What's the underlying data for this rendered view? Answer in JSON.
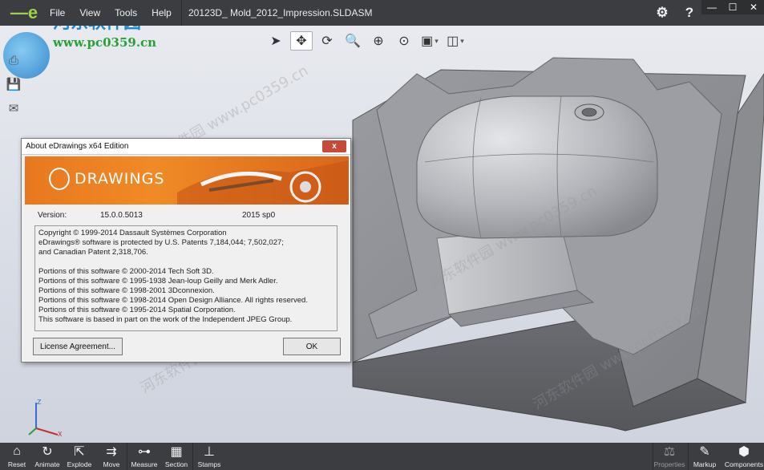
{
  "menu": [
    "File",
    "View",
    "Tools",
    "Help"
  ],
  "document_title": "20123D_ Mold_2012_Impression.SLDASM",
  "top_icons": [
    "gear-icon",
    "help-icon"
  ],
  "window_controls": [
    "—",
    "☐",
    "✕"
  ],
  "watermark": {
    "title": "河东软件园",
    "url": "www.pc0359.cn",
    "diagonal": "河东软件园 www.pc0359.cn"
  },
  "view_toolbar": [
    "select-icon",
    "pan-icon",
    "rotate-icon",
    "zoom-to-fit-icon",
    "zoom-icon",
    "zoom-area-icon",
    "views-icon",
    "display-style-icon"
  ],
  "dialog": {
    "title": "About eDrawings x64 Edition",
    "close": "x",
    "banner": "DRAWINGS",
    "version_label": "Version:",
    "version": "15.0.0.5013",
    "sp": "2015 sp0",
    "lines": [
      "Copyright © 1999-2014 Dassault Systèmes Corporation",
      "eDrawings® software is protected by U.S. Patents 7,184,044; 7,502,027;",
      "and Canadian Patent 2,318,706.",
      "",
      "Portions of this software © 2000-2014 Tech Soft 3D.",
      "Portions of this software © 1995-1938 Jean-loup Geilly and Merk Adler.",
      "Portions of this software © 1998-2001 3Dconnexion.",
      "Portions of this software © 1998-2014 Open Design Alliance. All rights reserved.",
      "Portions of this software © 1995-2014 Spatial Corporation.",
      "This software is based in part on the work of the Independent JPEG Group."
    ],
    "license_button": "License Agreement...",
    "ok_button": "OK"
  },
  "bottom_toolbar": {
    "left": [
      {
        "label": "Reset",
        "icon": "home-icon"
      },
      {
        "label": "Animate",
        "icon": "animate-icon"
      },
      {
        "label": "Explode",
        "icon": "explode-icon"
      },
      {
        "label": "Move",
        "icon": "move-icon"
      },
      {
        "label": "Measure",
        "icon": "measure-icon"
      },
      {
        "label": "Section",
        "icon": "section-icon"
      },
      {
        "label": "Stamps",
        "icon": "stamps-icon"
      }
    ],
    "right": [
      {
        "label": "Properties",
        "icon": "scales-icon",
        "dim": true
      },
      {
        "label": "Markup",
        "icon": "pen-icon"
      },
      {
        "label": "Components",
        "icon": "cube-icon"
      }
    ]
  },
  "colors": {
    "chrome": "#3c3d40",
    "banner_orange": "#f08a26",
    "close_red": "#c74a38"
  }
}
